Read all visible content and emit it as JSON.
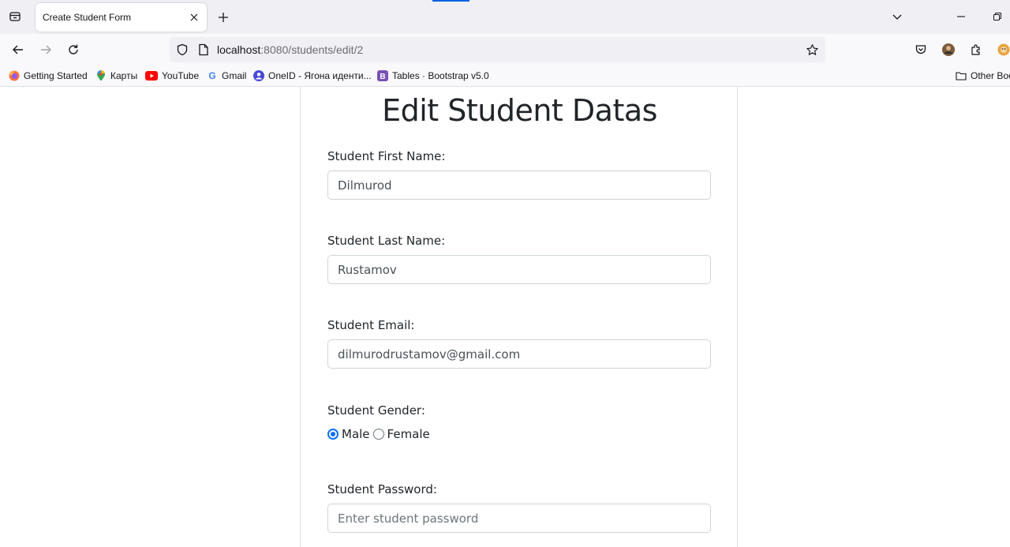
{
  "browser": {
    "tab": {
      "title": "Create Student Form"
    },
    "address": {
      "host": "localhost",
      "path": ":8080/students/edit/2"
    },
    "bookmarks": [
      {
        "label": "Getting Started",
        "icon": "firefox-icon"
      },
      {
        "label": "Карты",
        "icon": "maps-pin-icon"
      },
      {
        "label": "YouTube",
        "icon": "youtube-icon"
      },
      {
        "label": "Gmail",
        "icon": "google-icon"
      },
      {
        "label": "OneID - Ягона иденти...",
        "icon": "oneid-icon"
      },
      {
        "label": "Tables · Bootstrap v5.0",
        "icon": "bootstrap-icon"
      }
    ],
    "other_bookmarks": "Other Boo"
  },
  "form": {
    "heading": "Edit Student Datas",
    "first_name": {
      "label": "Student First Name:",
      "value": "Dilmurod"
    },
    "last_name": {
      "label": "Student Last Name:",
      "value": "Rustamov"
    },
    "email": {
      "label": "Student Email:",
      "value": "dilmurodrustamov@gmail.com"
    },
    "gender": {
      "label": "Student Gender:",
      "options": [
        {
          "label": "Male",
          "checked": true
        },
        {
          "label": "Female",
          "checked": false
        }
      ]
    },
    "password": {
      "label": "Student Password:",
      "value": "",
      "placeholder": "Enter student password"
    }
  },
  "colors": {
    "accent": "#0d6efd",
    "browser_accent": "#0061e0",
    "text": "#212529"
  }
}
